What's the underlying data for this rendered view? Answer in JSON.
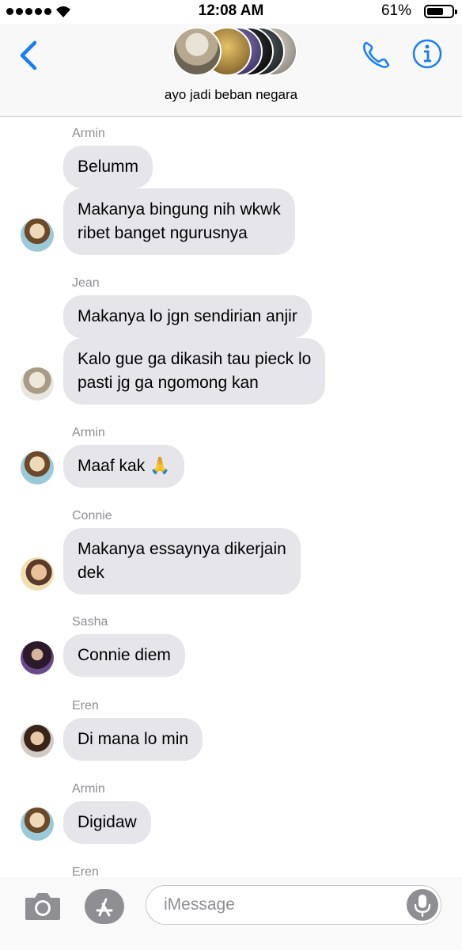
{
  "status_bar": {
    "time": "12:08 AM",
    "battery": "61%"
  },
  "header": {
    "group_name": "ayo jadi beban negara"
  },
  "messages": [
    {
      "sender": "Armin",
      "bubbles": [
        "Belumm",
        "Makanya bingung nih wkwk\nribet banget ngurusnya"
      ]
    },
    {
      "sender": "Jean",
      "bubbles": [
        "Makanya lo jgn sendirian anjir",
        "Kalo gue ga dikasih tau pieck lo\npasti jg ga ngomong kan"
      ]
    },
    {
      "sender": "Armin",
      "bubbles": [
        "Maaf kak 🙏"
      ]
    },
    {
      "sender": "Connie",
      "bubbles": [
        "Makanya essaynya dikerjain\ndek"
      ]
    },
    {
      "sender": "Sasha",
      "bubbles": [
        "Connie diem"
      ]
    },
    {
      "sender": "Eren",
      "bubbles": [
        "Di mana lo min"
      ]
    },
    {
      "sender": "Armin",
      "bubbles": [
        "Digidaw"
      ]
    },
    {
      "sender": "Eren",
      "bubbles": []
    }
  ],
  "composer": {
    "placeholder": "iMessage"
  },
  "colors": {
    "accent": "#147efb",
    "bubble": "#e5e5ea",
    "sender_label": "#8e8e93"
  },
  "icons": [
    "back-chevron-icon",
    "phone-icon",
    "info-icon",
    "camera-icon",
    "app-store-icon",
    "microphone-icon"
  ]
}
